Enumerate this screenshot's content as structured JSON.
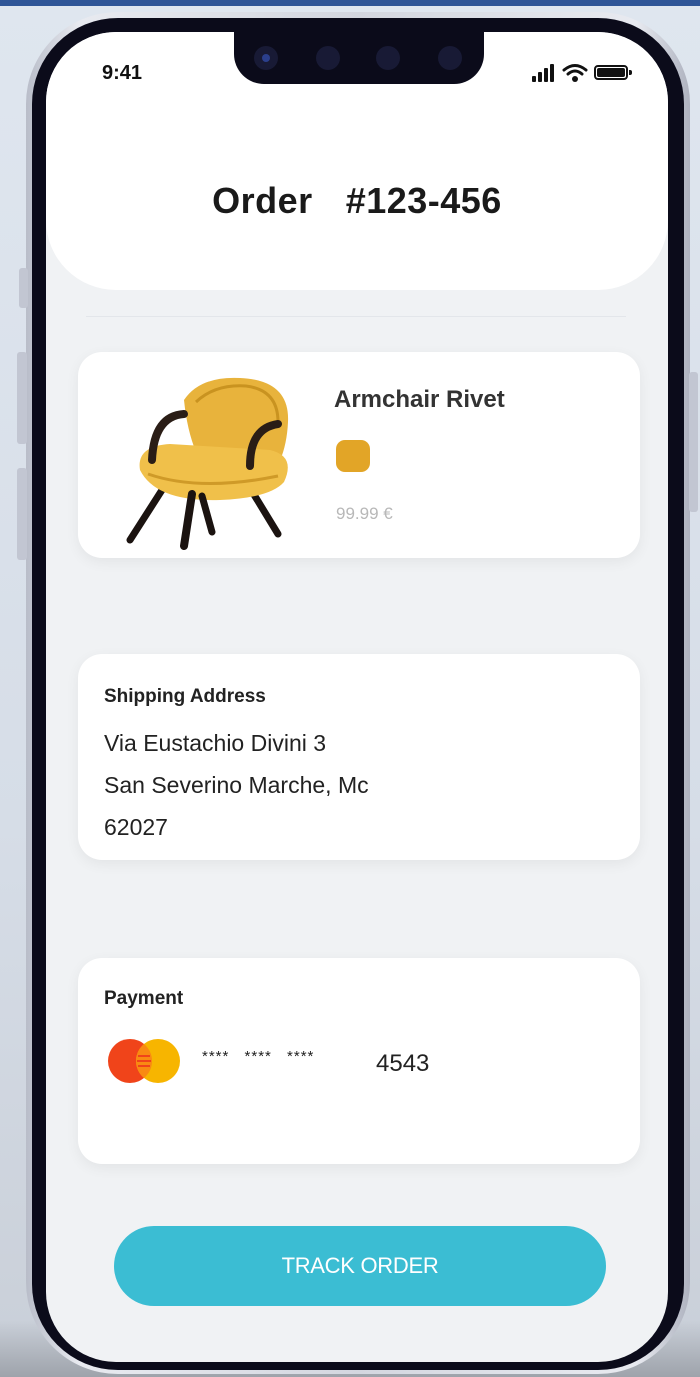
{
  "status_bar": {
    "time": "9:41",
    "icons": [
      "signal-icon",
      "wifi-icon",
      "battery-icon"
    ]
  },
  "header": {
    "title": "Order  #123-456"
  },
  "product": {
    "name": "Armchair Rivet",
    "color_swatch": "#e2a527",
    "price": "99.99 €",
    "image": "armchair-image"
  },
  "shipping": {
    "heading": "Shipping Address",
    "line1": "Via Eustachio Divini 3",
    "line2": "San Severino Marche, Mc",
    "line3": "62027"
  },
  "payment": {
    "heading": "Payment",
    "card_brand_icon": "mastercard-icon",
    "masked": "**** **** ****",
    "last4": "4543"
  },
  "actions": {
    "track_label": "TRACK ORDER"
  },
  "colors": {
    "accent": "#3bbdd3",
    "screen_bg": "#f0f2f4",
    "swatch": "#e2a527"
  }
}
